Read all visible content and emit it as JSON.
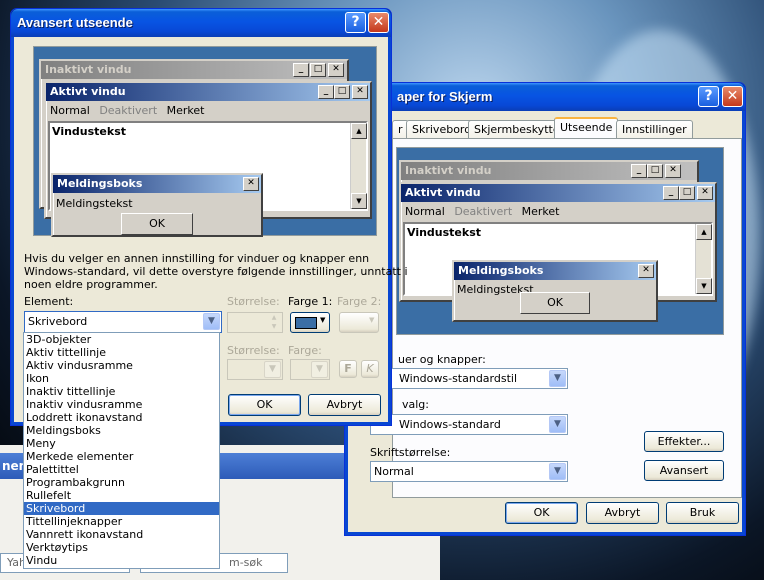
{
  "main_dialog": {
    "title": "Avansert utseende",
    "preview": {
      "inactive_title": "Inaktivt vindu",
      "active_title": "Aktivt vindu",
      "menu": [
        "Normal",
        "Deaktivert",
        "Merket"
      ],
      "window_text": "Vindustekst",
      "msgbox_title": "Meldingsboks",
      "msgbox_text": "Meldingstekst",
      "msgbox_ok": "OK"
    },
    "info_text_1": "Hvis du velger en annen innstilling for vinduer og knapper enn",
    "info_text_2": "Windows-standard, vil dette overstyre følgende innstillinger, unntatt i",
    "info_text_3": "noen eldre programmer.",
    "element_label": "Element:",
    "element_value": "Skrivebord",
    "size_label": "Størrelse:",
    "color1_label": "Farge 1:",
    "color2_label": "Farge 2:",
    "font_size_label": "Størrelse:",
    "font_color_label": "Farge:",
    "bold_btn": "F",
    "italic_btn": "K",
    "ok": "OK",
    "cancel": "Avbryt",
    "color1_hex": "#3a6ea5",
    "element_options": [
      "3D-objekter",
      "Aktiv tittellinje",
      "Aktiv vindusramme",
      "Ikon",
      "Inaktiv tittellinje",
      "Inaktiv vindusramme",
      "Loddrett ikonavstand",
      "Meldingsboks",
      "Meny",
      "Merkede elementer",
      "Palettittel",
      "Programbakgrunn",
      "Rullefelt",
      "Skrivebord",
      "Tittellinjeknapper",
      "Vannrett ikonavstand",
      "Verktøytips",
      "Vindu"
    ],
    "selected_option_index": 13
  },
  "back_dialog": {
    "title": "aper for Skjerm",
    "tabs": [
      "r",
      "Skrivebord",
      "Skjermbeskytter",
      "Utseende",
      "Innstillinger"
    ],
    "active_tab": "Utseende",
    "preview": {
      "inactive_title": "Inaktivt vindu",
      "active_title": "Aktivt vindu",
      "menu": [
        "Normal",
        "Deaktivert",
        "Merket"
      ],
      "window_text": "Vindustekst",
      "msgbox_title": "Meldingsboks",
      "msgbox_text": "Meldingstekst",
      "msgbox_ok": "OK"
    },
    "style_label": "uer og knapper:",
    "style_value": "Windows-standardstil",
    "scheme_label": "valg:",
    "scheme_value": "Windows-standard",
    "font_size_label": "Skriftstørrelse:",
    "font_size_value": "Normal",
    "effects_btn": "Effekter...",
    "advanced_btn": "Avansert",
    "ok": "OK",
    "cancel": "Avbryt",
    "apply": "Bruk"
  },
  "taskbar": {
    "left_fragment": "nen",
    "search_left": "Yah",
    "search_right": "m-søk"
  }
}
